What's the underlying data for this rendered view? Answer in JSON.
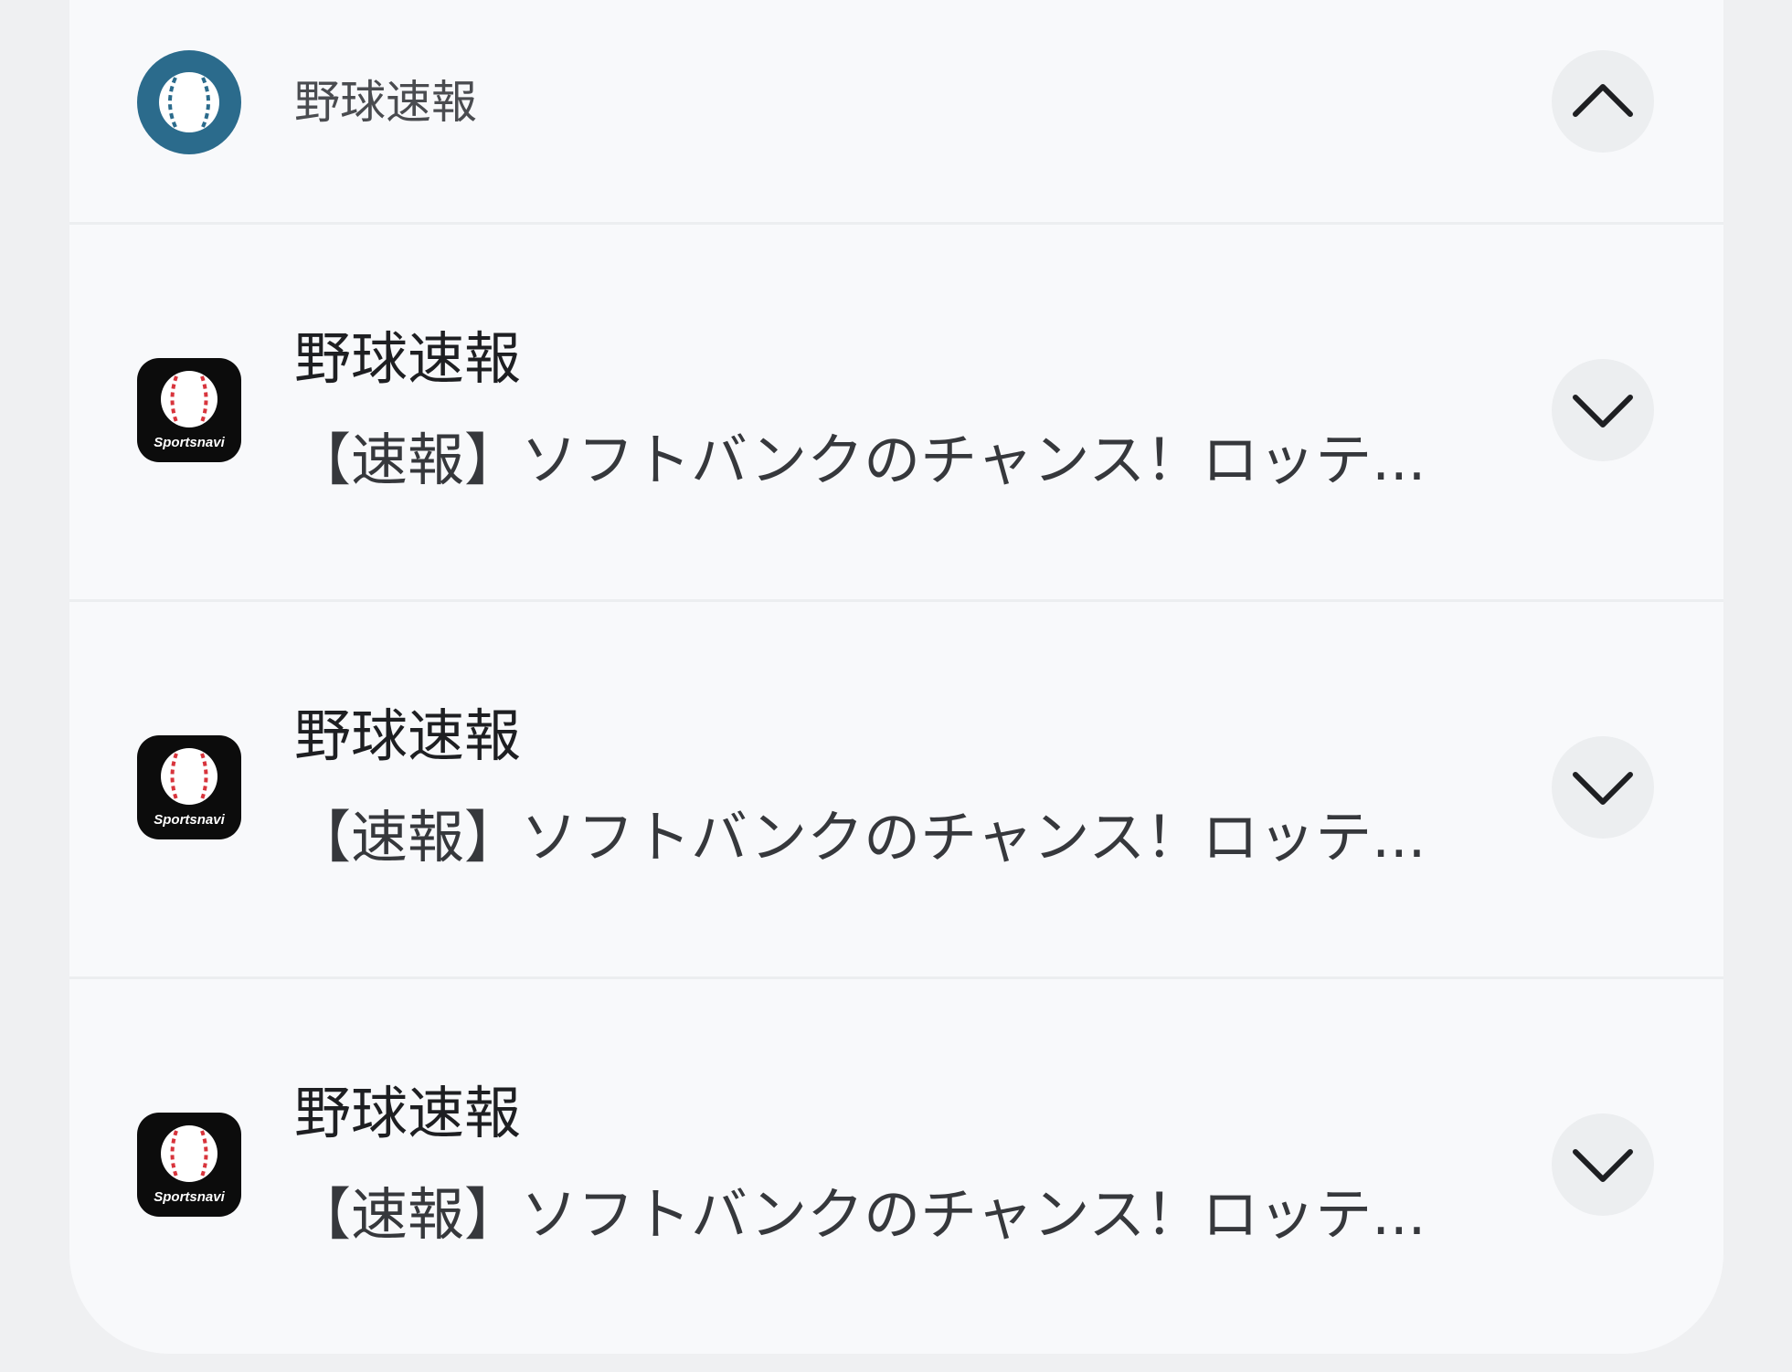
{
  "group": {
    "app_name": "野球速報",
    "icon": "baseball-circle-icon",
    "toggle_icon": "chevron-up-icon"
  },
  "notifications": [
    {
      "app_name": "野球速報",
      "text": "【速報】ソフトバンクのチャンス！ロッテ...",
      "icon": "sportsnavi-app-icon",
      "logo_text": "Sportsnavi",
      "toggle_icon": "chevron-down-icon"
    },
    {
      "app_name": "野球速報",
      "text": "【速報】ソフトバンクのチャンス！ロッテ...",
      "icon": "sportsnavi-app-icon",
      "logo_text": "Sportsnavi",
      "toggle_icon": "chevron-down-icon"
    },
    {
      "app_name": "野球速報",
      "text": "【速報】ソフトバンクのチャンス！ロッテ...",
      "icon": "sportsnavi-app-icon",
      "logo_text": "Sportsnavi",
      "toggle_icon": "chevron-down-icon"
    }
  ],
  "colors": {
    "background": "#eff0f2",
    "panel": "#f8f9fb",
    "group_icon": "#2b6b8c",
    "app_icon_bg": "#0c0c0c",
    "seam_red": "#d8343c"
  }
}
